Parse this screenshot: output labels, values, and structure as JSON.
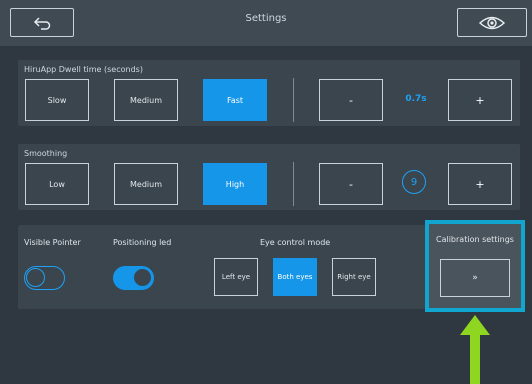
{
  "header": {
    "title": "Settings",
    "back_icon": "back-arrow-icon",
    "eye_icon": "eye-icon"
  },
  "dwell": {
    "label": "HiruApp Dwell time (seconds)",
    "options": [
      "Slow",
      "Medium",
      "Fast"
    ],
    "selected": "Fast",
    "decrement": "-",
    "value": "0.7s",
    "increment": "+"
  },
  "smoothing": {
    "label": "Smoothing",
    "options": [
      "Low",
      "Medium",
      "High"
    ],
    "selected": "High",
    "decrement": "-",
    "value": "9",
    "increment": "+"
  },
  "toggles": {
    "visible_pointer": {
      "label": "Visible Pointer",
      "state": "off"
    },
    "positioning_led": {
      "label": "Positioning led",
      "state": "on"
    }
  },
  "eye_control": {
    "label": "Eye control mode",
    "options": [
      "Left eye",
      "Both eyes",
      "Right eye"
    ],
    "selected": "Both eyes"
  },
  "calibration": {
    "label": "Calibration settings",
    "button": "»"
  },
  "colors": {
    "accent": "#1596e8",
    "highlight_frame": "#10a6d0",
    "arrow": "#8ed620",
    "background": "#2f3840"
  }
}
